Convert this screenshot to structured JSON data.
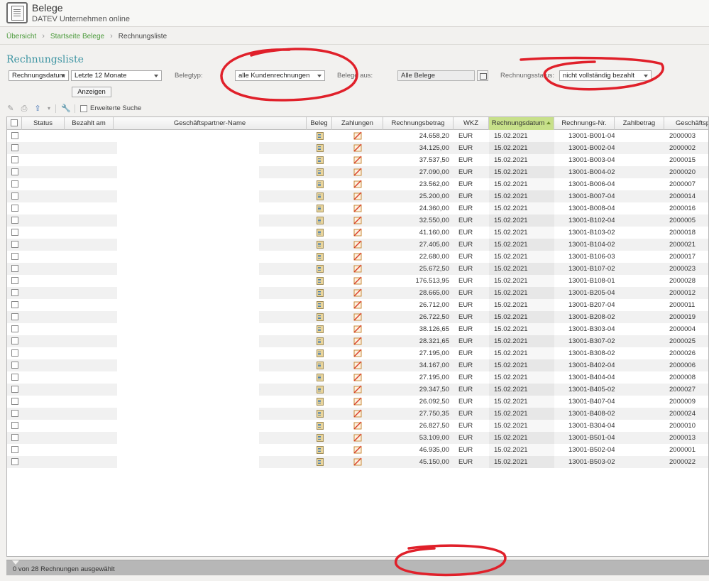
{
  "header": {
    "title": "Belege",
    "subtitle": "DATEV Unternehmen online"
  },
  "breadcrumb": {
    "items": [
      "Übersicht",
      "Startseite Belege"
    ],
    "current": "Rechnungsliste"
  },
  "page_title": "Rechnungsliste",
  "filters": {
    "date_field": "Rechnungsdatum",
    "period": "Letzte 12 Monate",
    "beleg_typ_label": "Belegtyp:",
    "beleg_typ_value": "alle Kundenrechnungen",
    "belege_aus_label": "Belege aus:",
    "belege_aus_value": "Alle Belege",
    "status_label": "Rechnungsstatus:",
    "status_value": "nicht vollständig bezahlt",
    "show_button": "Anzeigen"
  },
  "toolbar": {
    "extended_search": "Erweiterte Suche"
  },
  "grid": {
    "columns": [
      "Status",
      "Bezahlt am",
      "Geschäftspartner-Name",
      "Beleg",
      "Zahlungen",
      "Rechnungsbetrag",
      "WKZ",
      "Rechnungsdatum",
      "Rechnungs-Nr.",
      "Zahlbetrag",
      "Geschäftspar"
    ],
    "sorted_column": "Rechnungsdatum",
    "rows": [
      {
        "betrag": "24.658,20",
        "wkz": "EUR",
        "datum": "15.02.2021",
        "nr": "13001-B001-04",
        "partner": "2000003"
      },
      {
        "betrag": "34.125,00",
        "wkz": "EUR",
        "datum": "15.02.2021",
        "nr": "13001-B002-04",
        "partner": "2000002"
      },
      {
        "betrag": "37.537,50",
        "wkz": "EUR",
        "datum": "15.02.2021",
        "nr": "13001-B003-04",
        "partner": "2000015"
      },
      {
        "betrag": "27.090,00",
        "wkz": "EUR",
        "datum": "15.02.2021",
        "nr": "13001-B004-02",
        "partner": "2000020"
      },
      {
        "betrag": "23.562,00",
        "wkz": "EUR",
        "datum": "15.02.2021",
        "nr": "13001-B006-04",
        "partner": "2000007"
      },
      {
        "betrag": "25.200,00",
        "wkz": "EUR",
        "datum": "15.02.2021",
        "nr": "13001-B007-04",
        "partner": "2000014"
      },
      {
        "betrag": "24.360,00",
        "wkz": "EUR",
        "datum": "15.02.2021",
        "nr": "13001-B008-04",
        "partner": "2000016"
      },
      {
        "betrag": "32.550,00",
        "wkz": "EUR",
        "datum": "15.02.2021",
        "nr": "13001-B102-04",
        "partner": "2000005"
      },
      {
        "betrag": "41.160,00",
        "wkz": "EUR",
        "datum": "15.02.2021",
        "nr": "13001-B103-02",
        "partner": "2000018"
      },
      {
        "betrag": "27.405,00",
        "wkz": "EUR",
        "datum": "15.02.2021",
        "nr": "13001-B104-02",
        "partner": "2000021"
      },
      {
        "betrag": "22.680,00",
        "wkz": "EUR",
        "datum": "15.02.2021",
        "nr": "13001-B106-03",
        "partner": "2000017"
      },
      {
        "betrag": "25.672,50",
        "wkz": "EUR",
        "datum": "15.02.2021",
        "nr": "13001-B107-02",
        "partner": "2000023"
      },
      {
        "betrag": "176.513,95",
        "wkz": "EUR",
        "datum": "15.02.2021",
        "nr": "13001-B108-01",
        "partner": "2000028"
      },
      {
        "betrag": "28.665,00",
        "wkz": "EUR",
        "datum": "15.02.2021",
        "nr": "13001-B205-04",
        "partner": "2000012"
      },
      {
        "betrag": "26.712,00",
        "wkz": "EUR",
        "datum": "15.02.2021",
        "nr": "13001-B207-04",
        "partner": "2000011"
      },
      {
        "betrag": "26.722,50",
        "wkz": "EUR",
        "datum": "15.02.2021",
        "nr": "13001-B208-02",
        "partner": "2000019"
      },
      {
        "betrag": "38.126,65",
        "wkz": "EUR",
        "datum": "15.02.2021",
        "nr": "13001-B303-04",
        "partner": "2000004"
      },
      {
        "betrag": "28.321,65",
        "wkz": "EUR",
        "datum": "15.02.2021",
        "nr": "13001-B307-02",
        "partner": "2000025"
      },
      {
        "betrag": "27.195,00",
        "wkz": "EUR",
        "datum": "15.02.2021",
        "nr": "13001-B308-02",
        "partner": "2000026"
      },
      {
        "betrag": "34.167,00",
        "wkz": "EUR",
        "datum": "15.02.2021",
        "nr": "13001-B402-04",
        "partner": "2000006"
      },
      {
        "betrag": "27.195,00",
        "wkz": "EUR",
        "datum": "15.02.2021",
        "nr": "13001-B404-04",
        "partner": "2000008"
      },
      {
        "betrag": "29.347,50",
        "wkz": "EUR",
        "datum": "15.02.2021",
        "nr": "13001-B405-02",
        "partner": "2000027"
      },
      {
        "betrag": "26.092,50",
        "wkz": "EUR",
        "datum": "15.02.2021",
        "nr": "13001-B407-04",
        "partner": "2000009"
      },
      {
        "betrag": "27.750,35",
        "wkz": "EUR",
        "datum": "15.02.2021",
        "nr": "13001-B408-02",
        "partner": "2000024"
      },
      {
        "betrag": "26.827,50",
        "wkz": "EUR",
        "datum": "15.02.2021",
        "nr": "13001-B304-04",
        "partner": "2000010"
      },
      {
        "betrag": "53.109,00",
        "wkz": "EUR",
        "datum": "15.02.2021",
        "nr": "13001-B501-04",
        "partner": "2000013"
      },
      {
        "betrag": "46.935,00",
        "wkz": "EUR",
        "datum": "15.02.2021",
        "nr": "13001-B502-04",
        "partner": "2000001"
      },
      {
        "betrag": "45.150,00",
        "wkz": "EUR",
        "datum": "15.02.2021",
        "nr": "13001-B503-02",
        "partner": "2000022"
      }
    ]
  },
  "statusbar": {
    "text": "0 von 28 Rechnungen ausgewählt"
  },
  "colors": {
    "accent_green": "#4a9a3a",
    "title_teal": "#3f95a3",
    "sorted_header": "#c7e08a",
    "annotation_red": "#e0202a"
  }
}
